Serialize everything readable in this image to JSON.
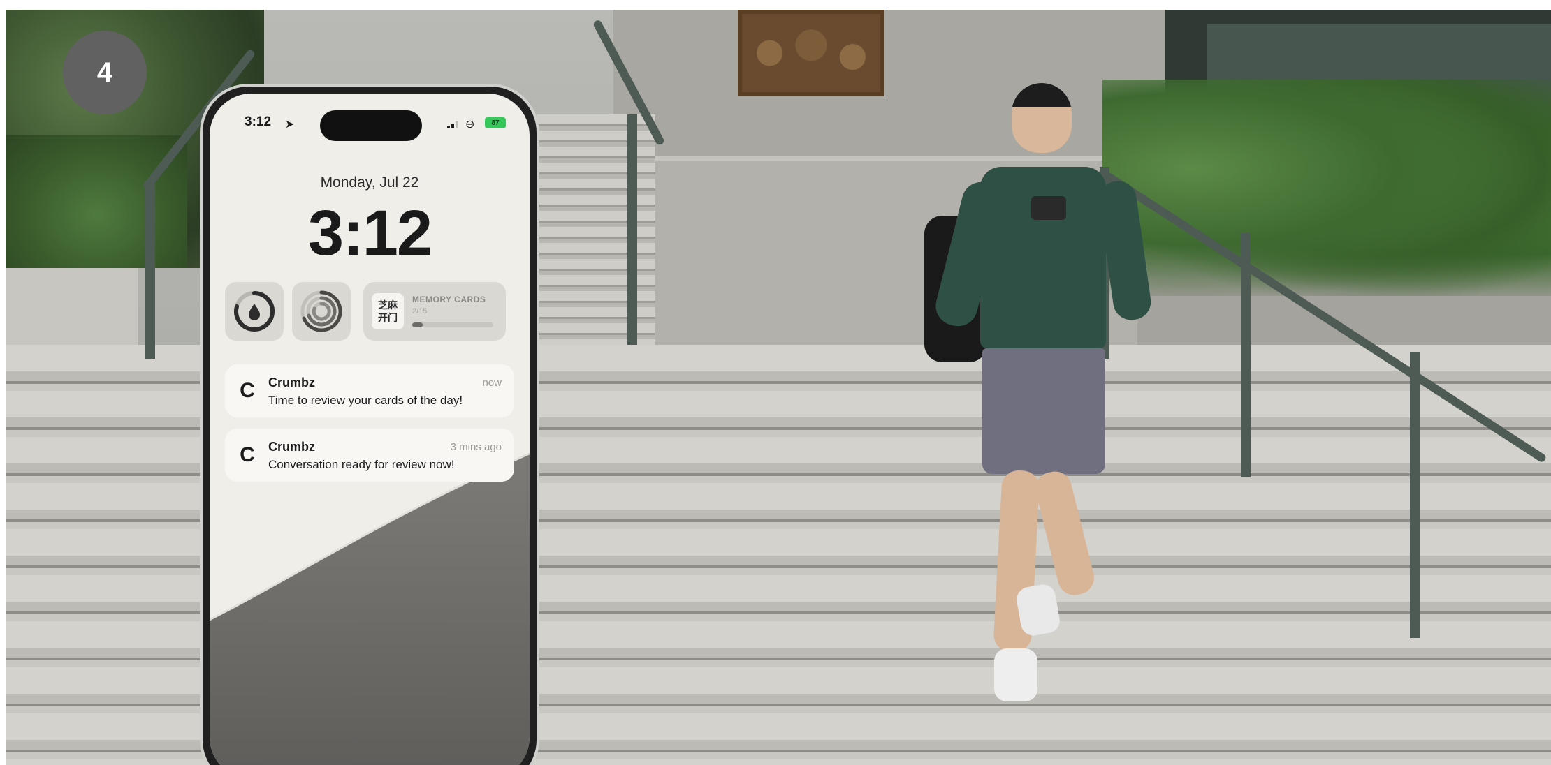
{
  "step": {
    "number": "4"
  },
  "phone": {
    "status_bar": {
      "time": "3:12",
      "battery_level": "87",
      "icons": [
        "location-arrow-icon",
        "signal-icon",
        "link-icon",
        "battery-icon"
      ]
    },
    "lock_screen": {
      "date": "Monday, Jul 22",
      "time": "3:12"
    },
    "widgets": [
      {
        "name": "water-drop-ring-widget",
        "icon": "water-drop-icon"
      },
      {
        "name": "activity-rings-widget",
        "icon": "rings-icon"
      },
      {
        "name": "memory-cards-widget",
        "chip_line1": "芝麻",
        "chip_line2": "开门",
        "title": "MEMORY CARDS",
        "count": "2/15",
        "progress": 0.13
      }
    ],
    "notifications": [
      {
        "app": "Crumbz",
        "time": "now",
        "message": "Time to review your cards of the day!",
        "icon": "crumbz-logo-icon"
      },
      {
        "app": "Crumbz",
        "time": "3 mins ago",
        "message": "Conversation ready for review now!",
        "icon": "crumbz-logo-icon"
      }
    ]
  },
  "colors": {
    "badge": "#616161",
    "lock_screen_bg": "#efeee9",
    "widget_bg": "#dad8d2",
    "battery": "#35c759"
  }
}
